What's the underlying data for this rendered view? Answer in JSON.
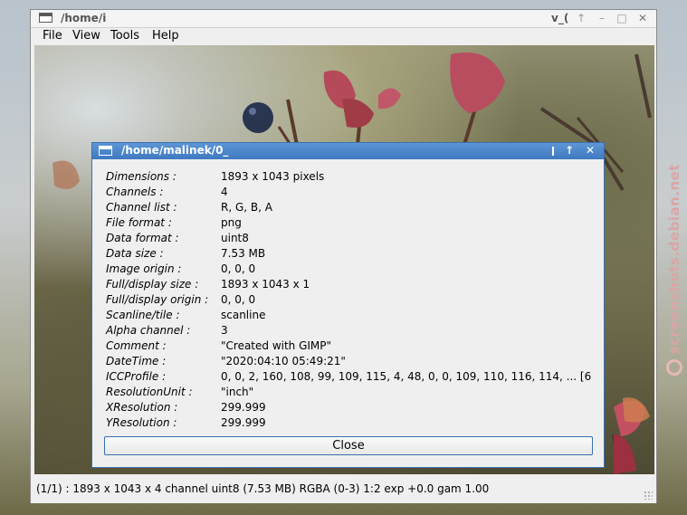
{
  "main_window": {
    "title": "/home/i",
    "title_right": "v_(",
    "controls": {
      "pin": "↑",
      "minimize": "–",
      "maximize": "□",
      "close": "✕"
    }
  },
  "menu": [
    {
      "label": "File"
    },
    {
      "label": "View"
    },
    {
      "label": "Tools"
    },
    {
      "label": "Help"
    }
  ],
  "dialog": {
    "title": "/home/malinek/0_",
    "controls": {
      "pin": "↑",
      "close": "✕"
    },
    "rows": [
      {
        "key": "Dimensions :",
        "value": "1893 x 1043 pixels"
      },
      {
        "key": "Channels :",
        "value": "4"
      },
      {
        "key": "Channel list :",
        "value": "R, G, B, A"
      },
      {
        "key": "File format :",
        "value": "png"
      },
      {
        "key": "Data format :",
        "value": "uint8"
      },
      {
        "key": "Data size :",
        "value": "7.53 MB"
      },
      {
        "key": "Image origin :",
        "value": "0, 0, 0"
      },
      {
        "key": "Full/display size :",
        "value": "1893 x 1043 x 1"
      },
      {
        "key": "Full/display origin :",
        "value": "0, 0, 0"
      },
      {
        "key": "Scanline/tile :",
        "value": "scanline"
      },
      {
        "key": "Alpha channel :",
        "value": "3"
      },
      {
        "key": "Comment :",
        "value": "\"Created with GIMP\""
      },
      {
        "key": "DateTime :",
        "value": "\"2020:04:10 05:49:21\""
      },
      {
        "key": "ICCProfile :",
        "value": "0, 0, 2, 160, 108, 99, 109, 115, 4, 48, 0, 0, 109, 110, 116, 114, ... [6"
      },
      {
        "key": "ResolutionUnit :",
        "value": "\"inch\""
      },
      {
        "key": "XResolution :",
        "value": "299.999"
      },
      {
        "key": "YResolution :",
        "value": "299.999"
      }
    ],
    "close_label": "Close"
  },
  "status": {
    "text": "(1/1) : 1893 x 1043 x 4 channel uint8 (7.53 MB)  RGBA (0-3)  1:2  exp +0.0  gam 1.00"
  },
  "watermark": "screenshots.debian.net"
}
